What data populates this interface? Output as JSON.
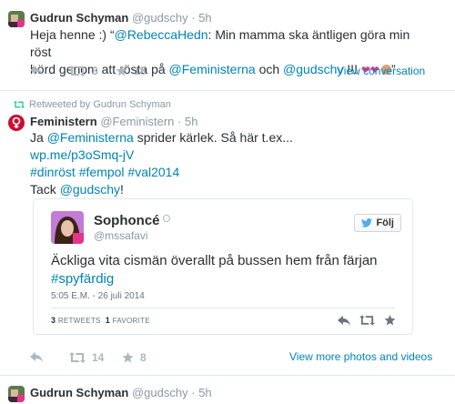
{
  "tweet1": {
    "name": "Gudrun Schyman",
    "handle": "@gudschy",
    "sep": "·",
    "time": "5h",
    "text_a": "Heja henne :) “",
    "mention_rebecca": "@RebeccaHedn",
    "text_b": ": Min mamma ska äntligen göra min röst",
    "text_c": "hörd genom att rösta på ",
    "mention_fem": "@Feministerna",
    "text_d": " och ",
    "mention_gud": "@gudschy",
    "text_e": " !!! ",
    "text_f": "”",
    "retweets": "3",
    "favorites": "18",
    "view_label": "View conversation"
  },
  "tweet2": {
    "retweeted_by": "Retweeted by Gudrun Schyman",
    "name": "Feministern",
    "handle": "@Feministern",
    "sep": "·",
    "time": "5h",
    "line1_a": "Ja ",
    "line1_mention": "@Feministerna",
    "line1_b": " sprider kärlek. Så här t.ex...",
    "line2_link": "wp.me/p3oSmq-jV",
    "tag1": "#dinröst",
    "tag2": "#fempol",
    "tag3": "#val2014",
    "line4_a": "Tack ",
    "line4_mention": "@gudschy",
    "line4_b": "!",
    "retweets": "14",
    "favorites": "8",
    "view_label": "View more photos and videos"
  },
  "embedded": {
    "name": "Sophoncé",
    "handle": "@mssafavi",
    "follow_label": "Följ",
    "text": "Äckliga vita cismän överallt på bussen hem från färjan",
    "hashtag": "#spyfärdig",
    "timestamp": "5:05 E.M. - 26 juli 2014",
    "retweets_count": "3",
    "retweets_label": "RETWEETS",
    "favorites_count": "1",
    "favorites_label": "FAVORITE"
  },
  "tweet3": {
    "name": "Gudrun Schyman",
    "handle": "@gudschy",
    "sep": "·",
    "time": "5h"
  },
  "colors": {
    "link": "#0084b4",
    "muted": "#8899a6",
    "action": "#aab8c2",
    "retweet_green": "#19cf86",
    "feminist_red": "#c8102e"
  },
  "icons": {
    "reply": "reply-icon",
    "retweet": "retweet-icon",
    "favorite": "star-icon",
    "more": "more-icon",
    "follow": "twitter-bird-icon"
  }
}
